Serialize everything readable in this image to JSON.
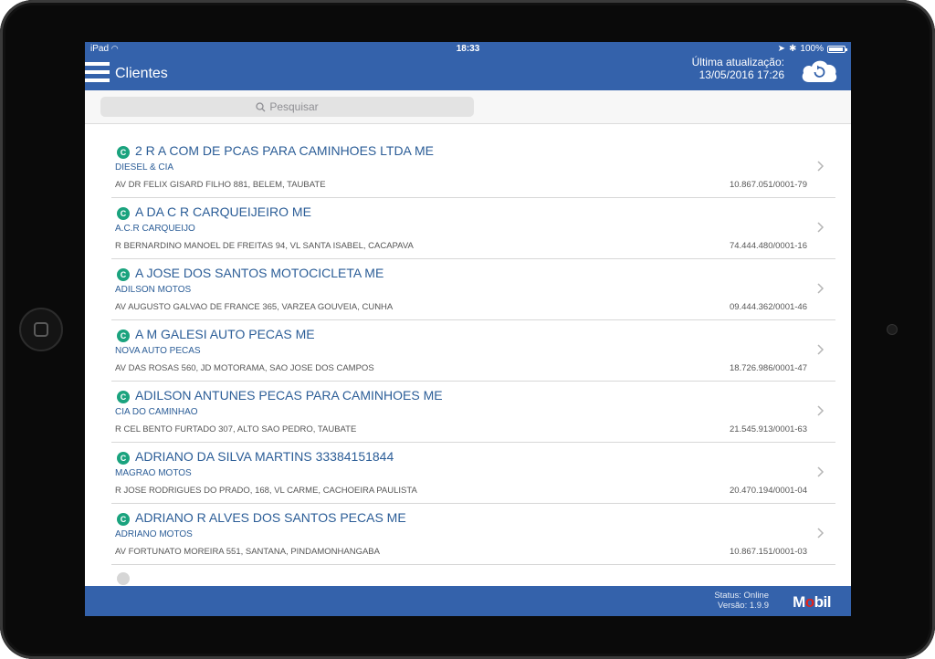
{
  "status_bar": {
    "device": "iPad",
    "time": "18:33",
    "battery": "100%",
    "battery_level": 1.0
  },
  "header": {
    "title": "Clientes",
    "update_label": "Última atualização:",
    "update_value": "13/05/2016 17:26",
    "refresh_icon": "cloud-refresh-icon",
    "menu_icon": "hamburger-menu-icon"
  },
  "search": {
    "placeholder": "Pesquisar"
  },
  "clients": [
    {
      "badge": "C",
      "name": "2 R A COM DE PCAS PARA CAMINHOES LTDA ME",
      "fantasy": "DIESEL & CIA",
      "address": "AV DR FELIX GISARD FILHO 881, BELEM, TAUBATE",
      "cnpj": "10.867.051/0001-79"
    },
    {
      "badge": "C",
      "name": "A  DA C R CARQUEIJEIRO ME",
      "fantasy": "A.C.R CARQUEIJO",
      "address": "R BERNARDINO MANOEL DE FREITAS 94, VL SANTA ISABEL, CACAPAVA",
      "cnpj": "74.444.480/0001-16"
    },
    {
      "badge": "C",
      "name": "A JOSE DOS SANTOS MOTOCICLETA ME",
      "fantasy": "ADILSON MOTOS",
      "address": "AV AUGUSTO GALVAO DE FRANCE 365, VARZEA GOUVEIA, CUNHA",
      "cnpj": "09.444.362/0001-46"
    },
    {
      "badge": "C",
      "name": "A M GALESI AUTO PECAS ME",
      "fantasy": "NOVA AUTO PECAS",
      "address": "AV DAS ROSAS 560, JD MOTORAMA, SAO JOSE DOS CAMPOS",
      "cnpj": "18.726.986/0001-47"
    },
    {
      "badge": "C",
      "name": "ADILSON ANTUNES PECAS PARA CAMINHOES ME",
      "fantasy": "CIA DO CAMINHAO",
      "address": "R CEL BENTO FURTADO 307, ALTO SAO PEDRO, TAUBATE",
      "cnpj": "21.545.913/0001-63"
    },
    {
      "badge": "C",
      "name": "ADRIANO DA SILVA MARTINS 33384151844",
      "fantasy": "MAGRAO MOTOS",
      "address": "R JOSE RODRIGUES DO PRADO, 168, VL CARME, CACHOEIRA PAULISTA",
      "cnpj": "20.470.194/0001-04"
    },
    {
      "badge": "C",
      "name": "ADRIANO R ALVES DOS SANTOS PECAS ME",
      "fantasy": "ADRIANO MOTOS",
      "address": "AV FORTUNATO MOREIRA 551, SANTANA, PINDAMONHANGABA",
      "cnpj": "10.867.151/0001-03"
    }
  ],
  "footer": {
    "status": "Status: Online",
    "version": "Versão: 1.9.9",
    "logo_prefix": "M",
    "logo_o": "o",
    "logo_suffix": "bil"
  },
  "colors": {
    "header_bg": "#3462ab",
    "badge": "#1aa37e",
    "client_text": "#2b5d97"
  }
}
